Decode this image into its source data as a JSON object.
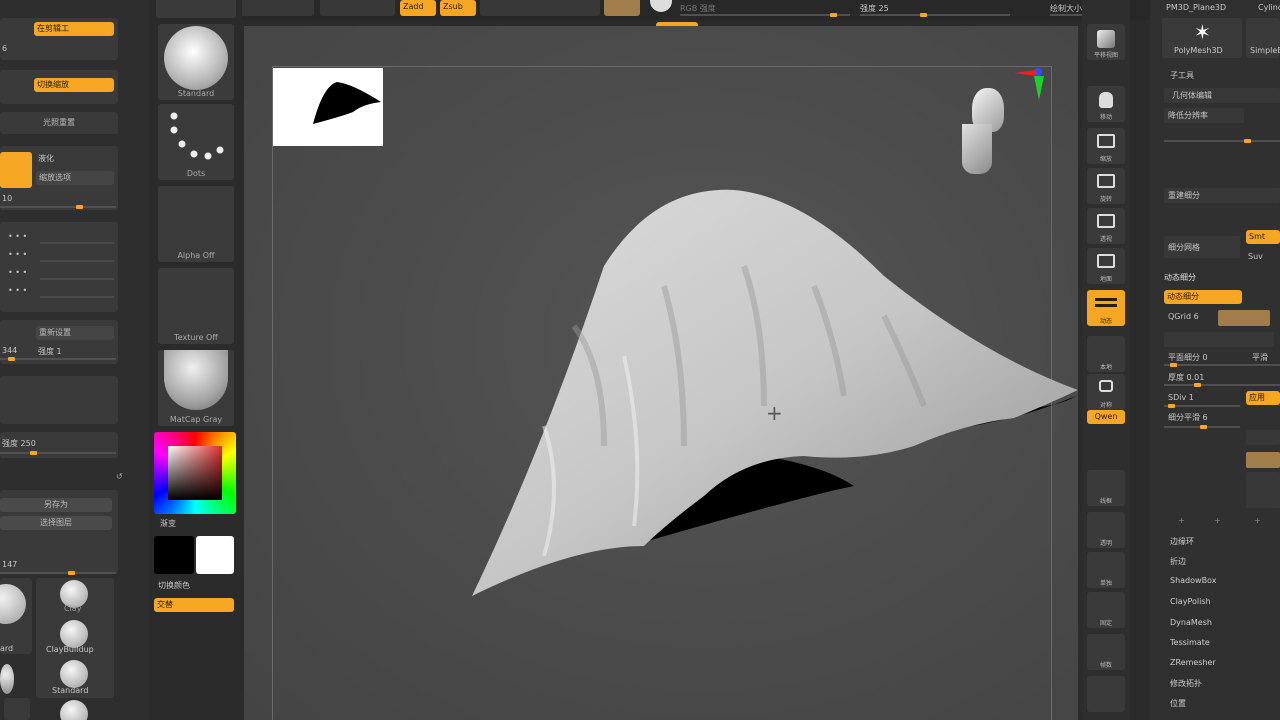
{
  "top_bar": {
    "draw_a": "Zadd",
    "draw_b": "Zsub",
    "rgb_label": "RGB 强度",
    "focal_label": "强度 25",
    "draw_size_label": "绘制大小 163"
  },
  "left_panel": {
    "btn_1": "在剪辑工",
    "btn_2": "切换缩放",
    "btn_3": "光照重置",
    "smooth_label": "液化",
    "scale_label": "缩放选项",
    "value_1": "10",
    "btn_redo": "重新设置",
    "value_2": "344",
    "value_2b": "强度 1",
    "value_3": "强度 250",
    "btn_save": "另存为",
    "btn_select": "选择图层",
    "value_4": "147",
    "brushes": [
      "Clay",
      "ClayBuildup",
      "Standard"
    ],
    "brush_left": "ard"
  },
  "tray": {
    "tiles": [
      "Standard",
      "Dots",
      "Alpha Off",
      "Texture Off",
      "MatCap Gray"
    ],
    "color_label": "渐变",
    "switch_label": "切换颜色",
    "fill_btn": "交替"
  },
  "shelf": {
    "buttons": [
      "平移视图",
      "移动",
      "缩放",
      "旋转",
      "透视",
      "地面",
      "本地",
      "对称",
      "线框",
      "透明",
      "单独",
      "固定",
      "帧数"
    ],
    "active_btn": "动态",
    "small_btn": "Qwen"
  },
  "tool_panel": {
    "header": [
      "PM3D_Plane3D",
      "Cylinder"
    ],
    "polymesh_label": "PolyMesh3D",
    "simple_label": "SimpleB",
    "sub_tool": "子工具",
    "geometry": "几何体编辑",
    "subdiv": "降低分辨率",
    "reconstruct": "重建细分",
    "divide": "细分网格",
    "smt": "Smt",
    "suv": "Suv",
    "dynamic_subdiv": "动态细分",
    "dynamic_btn": "动态细分",
    "qgrid": "QGrid 6",
    "coverage": "平面细分 0",
    "flat_right": "平滑",
    "ambient": "厚度 0.01",
    "sdiv": "SDiv 1",
    "smooth_sub": "细分平滑 6",
    "apply": "应用",
    "items": [
      "边缘环",
      "折边",
      "ShadowBox",
      "ClayPolish",
      "DynaMesh",
      "Tessimate",
      "ZRemesher",
      "修改拓扑",
      "位置"
    ]
  }
}
